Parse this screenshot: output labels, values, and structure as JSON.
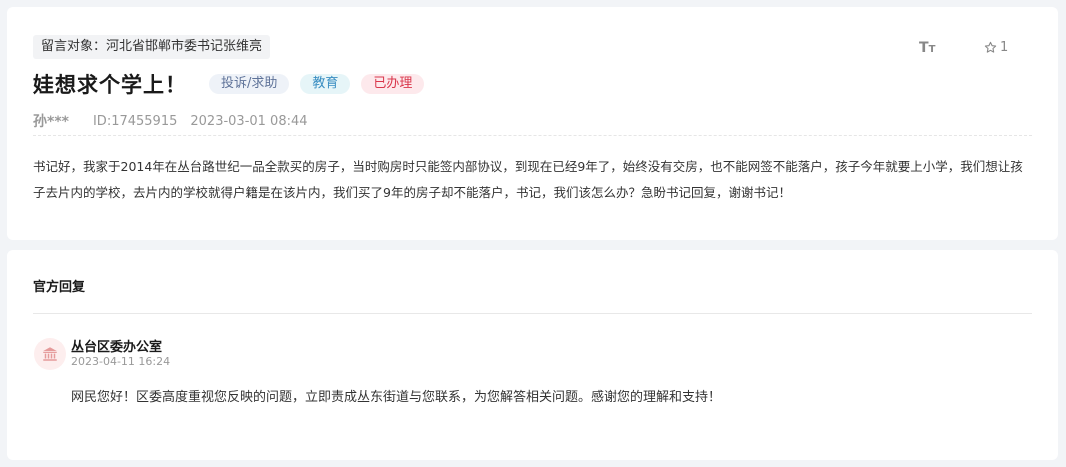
{
  "message": {
    "target": "留言对象：河北省邯郸市委书记张维亮",
    "title": "娃想求个学上！",
    "tags": {
      "type": "投诉/求助",
      "category": "教育",
      "status": "已办理"
    },
    "author": "孙***",
    "id_text": "ID:17455915",
    "datetime": "2023-03-01 08:44",
    "content": "书记好，我家于2014年在丛台路世纪一品全款买的房子，当时购房时只能签内部协议，到现在已经9年了，始终没有交房，也不能网签不能落户，孩子今年就要上小学，我们想让孩子去片内的学校，去片内的学校就得户籍是在该片内，我们买了9年的房子却不能落户，书记，我们该怎么办？急盼书记回复，谢谢书记！",
    "font_toggle": {
      "large": "T",
      "small": "T"
    },
    "favorite_count": "1",
    "icons": {
      "favorite": "star-outline-icon",
      "font": "font-size-icon"
    }
  },
  "reply": {
    "heading": "官方回复",
    "org_name": "丛台区委办公室",
    "datetime": "2023-04-11 16:24",
    "content": "网民您好！区委高度重视您反映的问题，立即责成丛东街道与您联系，为您解答相关问题。感谢您的理解和支持！",
    "icons": {
      "org": "government-building-icon"
    }
  },
  "colors": {
    "status_red": "#d9364b",
    "category_blue": "#3a8ec2",
    "type_slate": "#5f7399"
  }
}
